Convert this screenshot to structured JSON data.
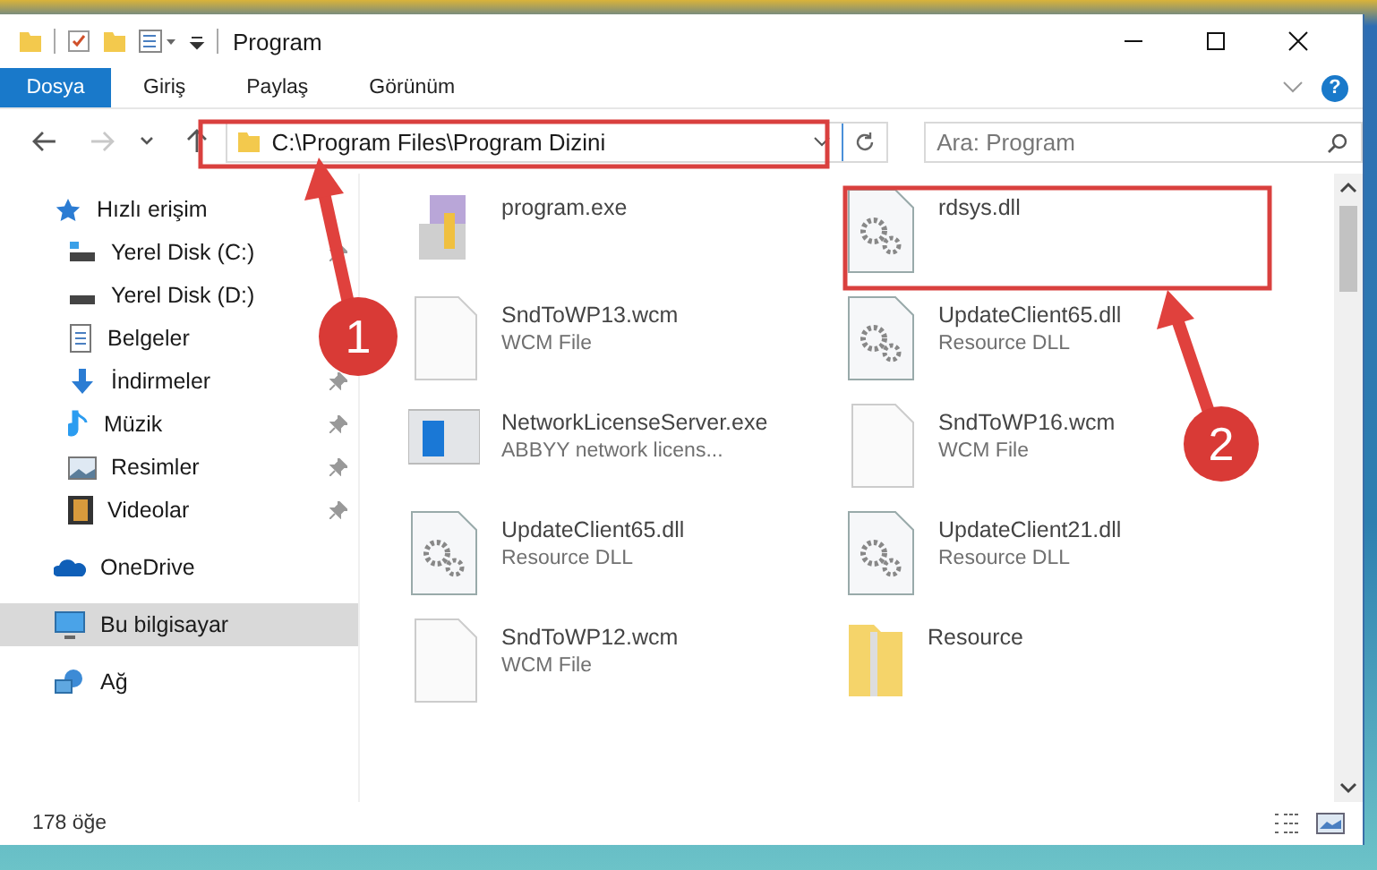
{
  "window": {
    "title": "Program"
  },
  "ribbon": {
    "tabs": [
      {
        "label": "Dosya",
        "kind": "file"
      },
      {
        "label": "Giriş",
        "kind": "tab"
      },
      {
        "label": "Paylaş",
        "kind": "tab"
      },
      {
        "label": "Görünüm",
        "kind": "tab"
      }
    ],
    "help": "?"
  },
  "nav_buttons": [
    {
      "kind": "back",
      "disabled": false
    },
    {
      "kind": "forward",
      "disabled": true
    },
    {
      "kind": "recent",
      "disabled": false
    },
    {
      "kind": "up",
      "disabled": false
    }
  ],
  "address": {
    "path": "C:\\Program Files\\Program Dizini"
  },
  "search": {
    "placeholder": "Ara: Program"
  },
  "sidebar": {
    "items": [
      {
        "label": "Hızlı erişim",
        "kind": "star",
        "selected": false,
        "children": [
          {
            "label": "Yerel Disk (C:)",
            "kind": "drive-win",
            "pinned": true,
            "selected": false
          },
          {
            "label": "Yerel Disk (D:)",
            "kind": "drive",
            "pinned": false,
            "selected": false
          },
          {
            "label": "Belgeler",
            "kind": "doc",
            "pinned": false,
            "selected": false
          },
          {
            "label": "İndirmeler",
            "kind": "download",
            "pinned": true,
            "selected": false
          },
          {
            "label": "Müzik",
            "kind": "music",
            "pinned": true,
            "selected": false
          },
          {
            "label": "Resimler",
            "kind": "pictures",
            "pinned": true,
            "selected": false
          },
          {
            "label": "Videolar",
            "kind": "video",
            "pinned": true,
            "selected": false
          }
        ]
      },
      {
        "label": "OneDrive",
        "kind": "cloud",
        "selected": false
      },
      {
        "label": "Bu bilgisayar",
        "kind": "computer",
        "selected": true
      },
      {
        "label": "Ağ",
        "kind": "network",
        "selected": false
      }
    ]
  },
  "files": [
    {
      "name": "program.exe",
      "kind": "installer"
    },
    {
      "name": "rdsys.dll",
      "kind": "dll"
    },
    {
      "name": "SndToWP13.wcm",
      "type": "WCM File",
      "kind": "blank"
    },
    {
      "name": "UpdateClient65.dll",
      "type": "Resource DLL",
      "kind": "dll"
    },
    {
      "name": "NetworkLicenseServer.exe",
      "type": "ABBYY network licens...",
      "kind": "app"
    },
    {
      "name": "SndToWP16.wcm",
      "type": "WCM File",
      "kind": "blank"
    },
    {
      "name": "UpdateClient65.dll",
      "type": "Resource DLL",
      "kind": "dll"
    },
    {
      "name": "UpdateClient21.dll",
      "type": "Resource DLL",
      "kind": "dll"
    },
    {
      "name": "SndToWP12.wcm",
      "type": "WCM File",
      "kind": "blank"
    },
    {
      "name": "Resource",
      "kind": "folder"
    }
  ],
  "annotations": [
    {
      "label": "1",
      "kind": "address"
    },
    {
      "label": "2",
      "kind": "file"
    }
  ],
  "status_bar": {
    "count": "178 öğe"
  }
}
